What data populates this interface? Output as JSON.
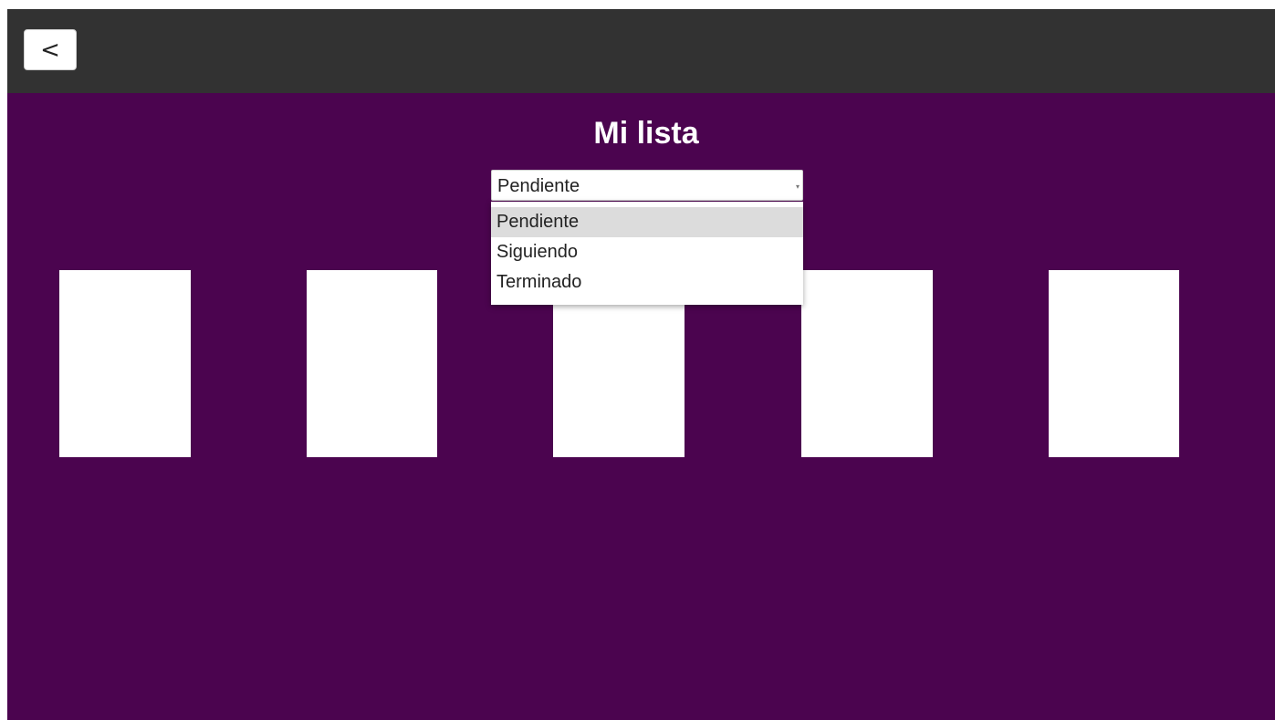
{
  "header": {
    "back_label": "<"
  },
  "main": {
    "title": "Mi lista",
    "status_select": {
      "selected": "Pendiente",
      "options": [
        "Pendiente",
        "Siguiendo",
        "Terminado"
      ],
      "highlighted_index": 0
    },
    "cards_count": 5
  },
  "colors": {
    "topbar": "#323232",
    "background": "#4b044f",
    "card": "#ffffff",
    "option_highlight": "#dcdcdc"
  }
}
